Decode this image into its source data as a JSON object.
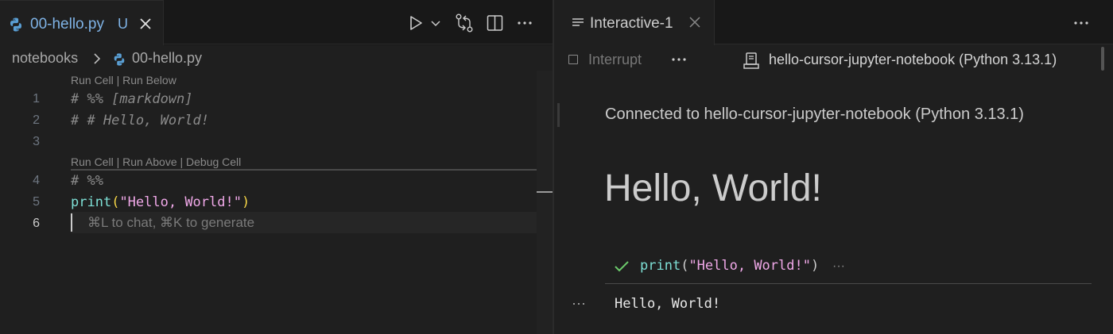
{
  "left_pane": {
    "tab": {
      "filename": "00-hello.py",
      "status": "U"
    },
    "breadcrumb": {
      "folder": "notebooks",
      "file": "00-hello.py"
    },
    "codelens": {
      "cell1": "Run Cell | Run Below",
      "cell2": "Run Cell | Run Above | Debug Cell"
    },
    "lines": [
      {
        "number": "1",
        "text": "# %% [markdown]"
      },
      {
        "number": "2",
        "text": "# # Hello, World!"
      },
      {
        "number": "3",
        "text": ""
      },
      {
        "number": "4",
        "text": "# %%"
      },
      {
        "number": "5",
        "fn": "print",
        "open": "(",
        "str": "\"Hello, World!\"",
        "close": ")"
      },
      {
        "number": "6",
        "text": ""
      }
    ],
    "hint": "⌘L to chat, ⌘K to generate"
  },
  "right_pane": {
    "tab": {
      "label": "Interactive-1"
    },
    "toolbar": {
      "interrupt_label": "Interrupt",
      "kernel_label": "hello-cursor-jupyter-notebook (Python 3.13.1)"
    },
    "connected_text": "Connected to hello-cursor-jupyter-notebook (Python 3.13.1)",
    "heading": "Hello, World!",
    "cell": {
      "fn": "print",
      "open": "(",
      "str": "\"Hello, World!\"",
      "close": ")",
      "more": "···"
    },
    "output_more": "···",
    "output": "Hello, World!"
  },
  "colors": {
    "accent_tab_text": "#7fb3e6",
    "function": "#7ee0d6",
    "string": "#f0a8e8",
    "paren": "#f5d547",
    "success_check": "#6ccb6c"
  },
  "icons": [
    "python-icon",
    "close-icon",
    "play-icon",
    "chevron-down-icon",
    "compare-changes-icon",
    "split-editor-icon",
    "more-icon",
    "chevron-right-icon",
    "lines-icon",
    "stop-icon",
    "kernel-icon",
    "check-icon"
  ]
}
